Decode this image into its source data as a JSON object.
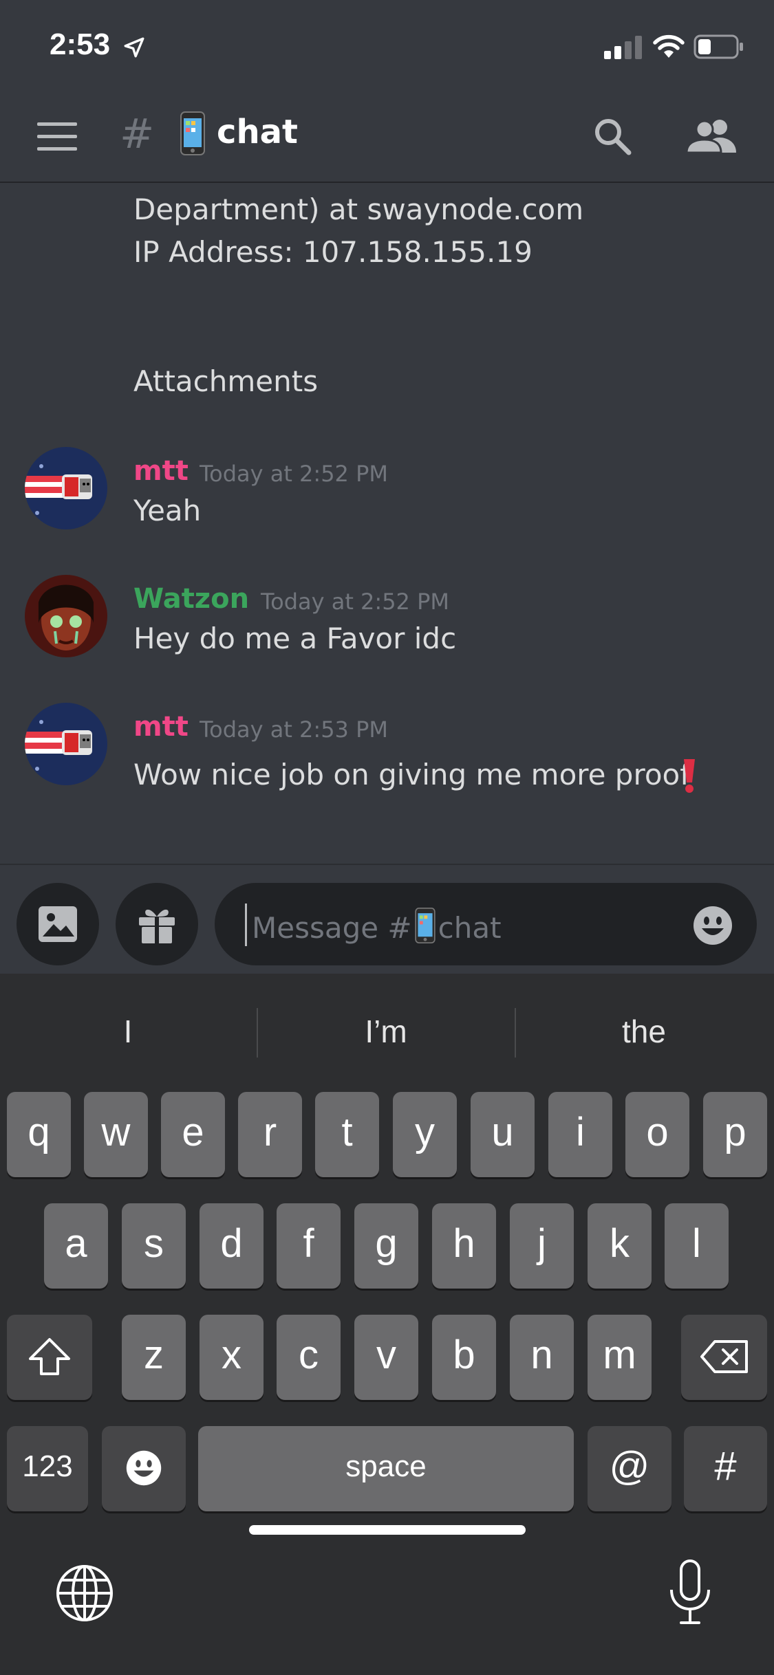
{
  "status_bar": {
    "time": "2:53"
  },
  "header": {
    "channel_prefix": "#",
    "channel_name": "chat"
  },
  "messages": {
    "partial_lines": [
      "Department) at swaynode.com",
      "IP Address: 107.158.155.19"
    ],
    "attachments_label": "Attachments",
    "items": [
      {
        "author": "mtt",
        "author_color": "#f04787",
        "timestamp": "Today at 2:52 PM",
        "text": "Yeah"
      },
      {
        "author": "Watzon",
        "author_color": "#3ba55c",
        "timestamp": "Today at 2:52 PM",
        "text": "Hey do me a Favor idc"
      },
      {
        "author": "mtt",
        "author_color": "#f04787",
        "timestamp": "Today at 2:53 PM",
        "text": "Wow nice job on giving me more proof"
      }
    ]
  },
  "composer": {
    "placeholder_prefix": "Message #",
    "placeholder_channel": "chat"
  },
  "keyboard": {
    "suggestions": [
      "I",
      "I’m",
      "the"
    ],
    "row1": [
      "q",
      "w",
      "e",
      "r",
      "t",
      "y",
      "u",
      "i",
      "o",
      "p"
    ],
    "row2": [
      "a",
      "s",
      "d",
      "f",
      "g",
      "h",
      "j",
      "k",
      "l"
    ],
    "row3": [
      "z",
      "x",
      "c",
      "v",
      "b",
      "n",
      "m"
    ],
    "numbers_label": "123",
    "space_label": "space",
    "at_label": "@",
    "hash_label": "#"
  }
}
